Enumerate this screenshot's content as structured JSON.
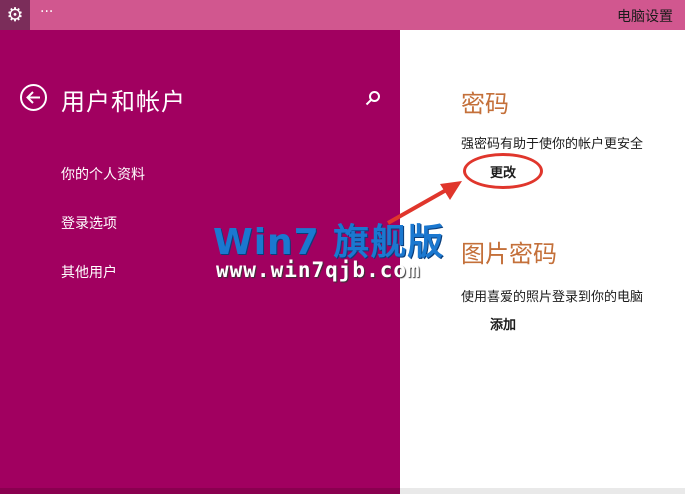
{
  "window": {
    "title": "电脑设置",
    "settings_icon": "gear-icon",
    "overflow_label": "···"
  },
  "sidebar": {
    "title": "用户和帐户",
    "back_icon": "back-arrow-icon",
    "search_icon": "search-icon",
    "items": [
      {
        "label": "你的个人资料"
      },
      {
        "label": "登录选项"
      },
      {
        "label": "其他用户"
      }
    ]
  },
  "content": {
    "password": {
      "title": "密码",
      "description": "强密码有助于使你的帐户更安全",
      "button": "更改"
    },
    "picture_password": {
      "title": "图片密码",
      "description": "使用喜爱的照片登录到你的电脑",
      "button": "添加"
    }
  },
  "watermark": {
    "text": "Win7 旗舰版",
    "url": "www.win7qjb.com"
  },
  "colors": {
    "titlebar": "#d1578f",
    "sidebar": "#a10060",
    "section_title": "#c4703a",
    "annotation": "#e0362c"
  }
}
